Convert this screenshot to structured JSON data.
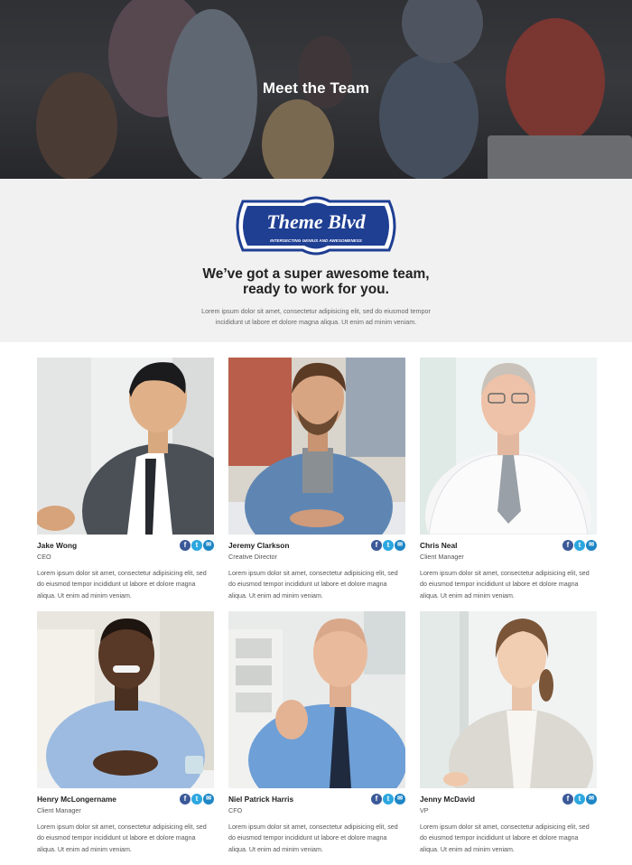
{
  "hero": {
    "title": "Meet the Team"
  },
  "logo": {
    "text": "Theme Blvd",
    "tagline": "INTERSECTING GENIUS AND AWESOMENESS"
  },
  "intro": {
    "headline_line1": "We’ve got a super awesome team,",
    "headline_line2": "ready to work for you.",
    "text_line1": "Lorem ipsum dolor sit amet, consectetur adipisicing elit, sed do eiusmod tempor",
    "text_line2": "incididunt ut labore et dolore magna aliqua. Ut enim ad minim veniam."
  },
  "social_icons": [
    "facebook-icon",
    "twitter-icon",
    "email-icon"
  ],
  "colors": {
    "facebook": "#3b5998",
    "twitter": "#2ca7e0",
    "email": "#1e86c6",
    "logo_blue": "#1f3f93"
  },
  "team": [
    {
      "name": "Jake Wong",
      "role": "CEO",
      "bio1": "Lorem ipsum dolor sit amet, consectetur adipisicing elit, sed",
      "bio2": "do eiusmod tempor incididunt ut labore et dolore magna",
      "bio3": "aliqua. Ut enim ad minim veniam."
    },
    {
      "name": "Jeremy Clarkson",
      "role": "Creative Director",
      "bio1": "Lorem ipsum dolor sit amet, consectetur adipisicing elit, sed",
      "bio2": "do eiusmod tempor incididunt ut labore et dolore magna",
      "bio3": "aliqua. Ut enim ad minim veniam."
    },
    {
      "name": "Chris Neal",
      "role": "Client Manager",
      "bio1": "Lorem ipsum dolor sit amet, consectetur adipisicing elit, sed",
      "bio2": "do eiusmod tempor incididunt ut labore et dolore magna",
      "bio3": "aliqua. Ut enim ad minim veniam."
    },
    {
      "name": "Henry McLongername",
      "role": "Client Manager",
      "bio1": "Lorem ipsum dolor sit amet, consectetur adipisicing elit, sed",
      "bio2": "do eiusmod tempor incididunt ut labore et dolore magna",
      "bio3": "aliqua. Ut enim ad minim veniam."
    },
    {
      "name": "Niel Patrick Harris",
      "role": "CFO",
      "bio1": "Lorem ipsum dolor sit amet, consectetur adipisicing elit, sed",
      "bio2": "do eiusmod tempor incididunt ut labore et dolore magna",
      "bio3": "aliqua. Ut enim ad minim veniam."
    },
    {
      "name": "Jenny McDavid",
      "role": "VP",
      "bio1": "Lorem ipsum dolor sit amet, consectetur adipisicing elit, sed",
      "bio2": "do eiusmod tempor incididunt ut labore et dolore magna",
      "bio3": "aliqua. Ut enim ad minim veniam."
    }
  ]
}
